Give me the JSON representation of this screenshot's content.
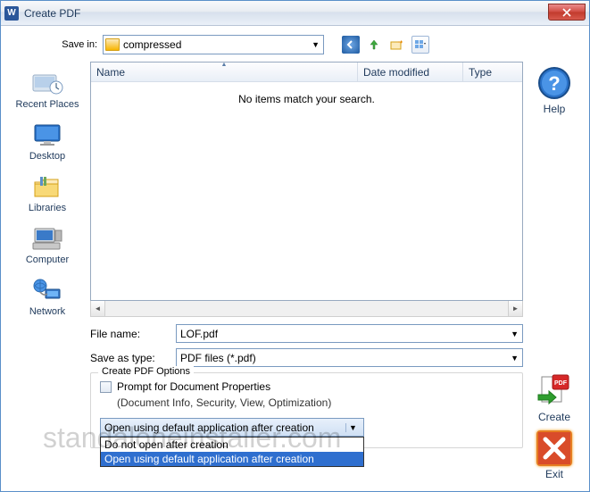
{
  "titlebar": {
    "title": "Create PDF"
  },
  "savein": {
    "label": "Save in:",
    "folder": "compressed"
  },
  "places": [
    {
      "label": "Recent Places"
    },
    {
      "label": "Desktop"
    },
    {
      "label": "Libraries"
    },
    {
      "label": "Computer"
    },
    {
      "label": "Network"
    }
  ],
  "filelist": {
    "cols": {
      "name": "Name",
      "date": "Date modified",
      "type": "Type"
    },
    "empty": "No items match your search."
  },
  "fields": {
    "filename_label": "File name:",
    "filename_value": "LOF.pdf",
    "savetype_label": "Save as type:",
    "savetype_value": "PDF files (*.pdf)"
  },
  "options": {
    "legend": "Create PDF Options",
    "prompt": "Prompt for Document Properties",
    "prompt_sub": "(Document Info, Security, View, Optimization)"
  },
  "aftercreate": {
    "selected": "Open using default application after creation",
    "opt1": "Do not open after creation",
    "opt2": "Open using default application after creation"
  },
  "right": {
    "help": "Help",
    "create": "Create",
    "exit": "Exit"
  },
  "watermark": "standaloneinstaller.com"
}
